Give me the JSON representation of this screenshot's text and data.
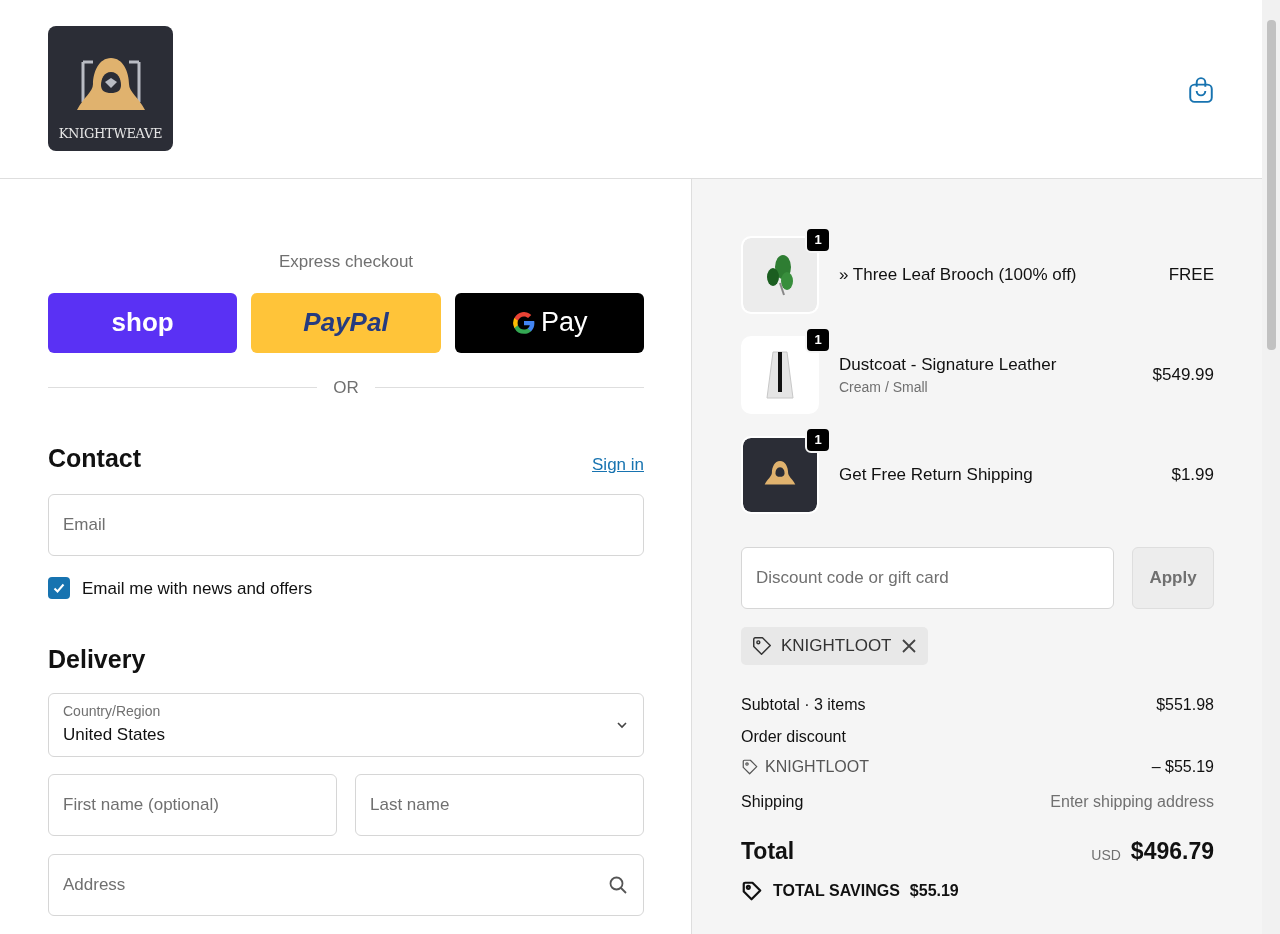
{
  "header": {
    "logo_text": "KNIGHTWEAVE"
  },
  "express": {
    "label": "Express checkout",
    "buttons": [
      {
        "kind": "shop",
        "label": "shop"
      },
      {
        "kind": "paypal",
        "label": "PayPal"
      },
      {
        "kind": "gpay",
        "label": "Pay"
      }
    ],
    "divider": "OR"
  },
  "contact": {
    "title": "Contact",
    "sign_in": "Sign in",
    "email": {
      "placeholder": "Email"
    },
    "newsletter": {
      "label": "Email me with news and offers",
      "checked": true
    }
  },
  "delivery": {
    "title": "Delivery",
    "country": {
      "label": "Country/Region",
      "value": "United States"
    },
    "first_name": {
      "placeholder": "First name (optional)"
    },
    "last_name": {
      "placeholder": "Last name"
    },
    "address": {
      "placeholder": "Address"
    }
  },
  "order": {
    "items": [
      {
        "name": "» Three Leaf Brooch (100% off)",
        "price": "FREE",
        "quantity": "1",
        "kind": "brooch"
      },
      {
        "name": "Dustcoat - Signature Leather",
        "variant": "Cream / Small",
        "price": "$549.99",
        "quantity": "1",
        "kind": "coat"
      },
      {
        "name": "Get Free Return Shipping",
        "price": "$1.99",
        "quantity": "1",
        "kind": "logo"
      }
    ],
    "discount": {
      "placeholder": "Discount code or gift card",
      "button": "Apply",
      "applied_code": "KNIGHTLOOT"
    },
    "summary": {
      "subtotal_label": "Subtotal · 3 items",
      "subtotal": "$551.98",
      "discount_label": "Order discount",
      "discount_code": "KNIGHTLOOT",
      "discount_amount": "– $55.19",
      "shipping_label": "Shipping",
      "shipping": "Enter shipping address",
      "total_label": "Total",
      "currency": "USD",
      "total": "$496.79",
      "savings_label": "TOTAL SAVINGS",
      "savings": "$55.19"
    }
  }
}
